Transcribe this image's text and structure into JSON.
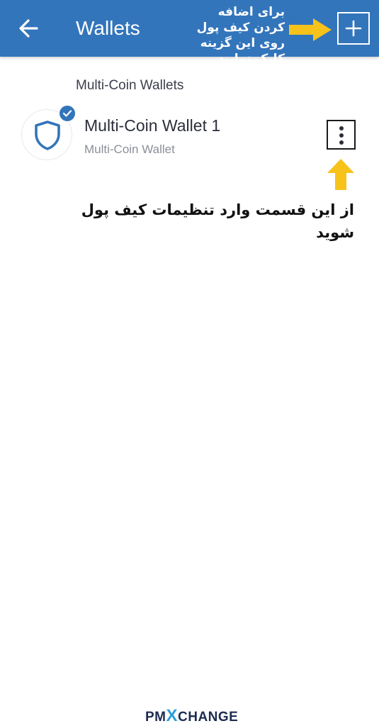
{
  "header": {
    "title": "Wallets",
    "note": "برای اضافه کردن کیف پول روی این گزینه کلیک نمایید"
  },
  "section": {
    "label": "Multi-Coin Wallets"
  },
  "wallet": {
    "name": "Multi-Coin Wallet 1",
    "subtitle": "Multi-Coin Wallet"
  },
  "annotation": {
    "settings_note": "از این قسمت وارد تنظیمات کیف پول شوید"
  },
  "watermark": {
    "brand_left": "PM",
    "brand_x": "X",
    "brand_right": "CHANGE"
  },
  "colors": {
    "app_bar": "#3375bb",
    "arrow": "#f7c21a",
    "accent": "#3375bb"
  },
  "icons": [
    "back-arrow-icon",
    "plus-icon",
    "shield-icon",
    "check-icon",
    "more-vertical-icon",
    "arrow-right-icon",
    "arrow-up-icon"
  ]
}
